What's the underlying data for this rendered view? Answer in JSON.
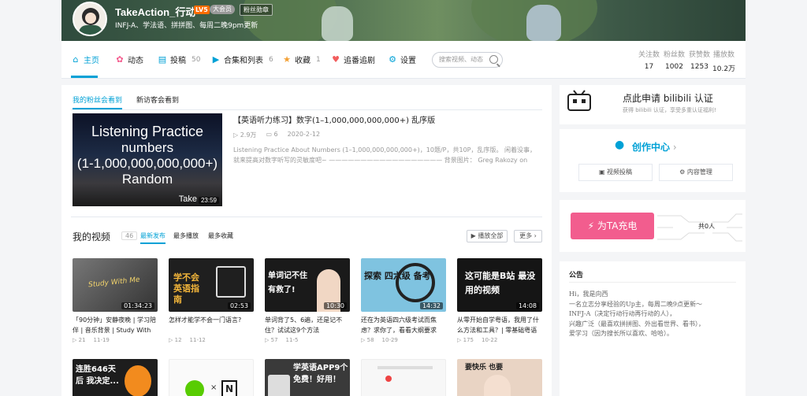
{
  "profile": {
    "username": "TakeAction_行动",
    "level": "LV5",
    "vip": "大会员",
    "fan_badge": "粉丝勋章",
    "sign": "INFJ-A、学法语、拼拼图、每周二晚9pm更新"
  },
  "nav": {
    "items": [
      {
        "label": "主页",
        "count": ""
      },
      {
        "label": "动态",
        "count": ""
      },
      {
        "label": "投稿",
        "count": "50"
      },
      {
        "label": "合集和列表",
        "count": "6"
      },
      {
        "label": "收藏",
        "count": "1"
      },
      {
        "label": "追番追剧",
        "count": ""
      },
      {
        "label": "设置",
        "count": ""
      }
    ],
    "search_placeholder": "搜索视频、动态",
    "stats": [
      {
        "label": "关注数",
        "value": "17"
      },
      {
        "label": "粉丝数",
        "value": "1002"
      },
      {
        "label": "获赞数",
        "value": "1253"
      },
      {
        "label": "播放数",
        "value": "10.2万"
      }
    ]
  },
  "featured": {
    "tabs": [
      "我的粉丝会看到",
      "新访客会看到"
    ],
    "thumb_lines": [
      "Listening Practice",
      "numbers",
      "(1-1,000,000,000,000+)",
      "Random"
    ],
    "thumb_corner": "Take",
    "duration": "23:59",
    "title": "【英语听力练习】数字(1–1,000,000,000,000+) 乱序版",
    "plays": "2.9万",
    "comments": "6",
    "date": "2020-2-12",
    "desc": "Listening Practice About Numbers (1–1,000,000,000,000+)，10题/P，共10P，乱序版。 闲着没事，就来提高对数字听写的灵敏度吧~ —————————————————— 背景图片： Greg Rakozy on"
  },
  "videos": {
    "header": "我的视频",
    "count": "46",
    "tabs": [
      "最新发布",
      "最多播放",
      "最多收藏"
    ],
    "play_all": "播放全部",
    "more": "更多",
    "items": [
      {
        "title": "「90分钟」安静夜晚 | 学习陪伴 | 音乐背景 | Study With",
        "thumb_text": "Study With Me",
        "duration": "01:34:23",
        "plays": "21",
        "date": "11-19"
      },
      {
        "title": "怎样才能学不会一门语言?",
        "thumb_text": "学不会英语指南",
        "duration": "02:53",
        "plays": "12",
        "date": "11-12"
      },
      {
        "title": "单词背了5、6遍，还是记不住？试试这9个方法",
        "thumb_text": "单词记不住 有救了!",
        "duration": "10:30",
        "plays": "57",
        "date": "11-5"
      },
      {
        "title": "还在为英语四六级考试而焦虑？求你了，看看大纲要求",
        "thumb_text": "探索 四六级 备考",
        "duration": "14:32",
        "plays": "58",
        "date": "10-29"
      },
      {
        "title": "从零开始自学粤语，我用了什么方法和工具？| 零基础粤语",
        "thumb_text": "这可能是B站 最没用的视频",
        "duration": "14:08",
        "plays": "175",
        "date": "10-22"
      }
    ],
    "row2": [
      {
        "thumb_text": "连胜646天后 我决定..."
      },
      {
        "thumb_text": "×"
      },
      {
        "thumb_text": "学英语APP9个 免费！好用！"
      },
      {
        "thumb_text": ""
      },
      {
        "thumb_text": "要快乐 也要"
      }
    ]
  },
  "side": {
    "apply_title": "点此申请 bilibili 认证",
    "apply_sub": "获得 bilibili 认证，享受多重认证福利!",
    "creator_title": "创作中心",
    "upload_btn": "视频投稿",
    "manage_btn": "内容管理",
    "charge_btn": "为TA充电",
    "charge_count": "共0人",
    "notice_title": "公告",
    "notice_body": "Hi，我是向西\n一名立志分享经验的Up主，每周二晚9点更新～\nINFJ-A（决定行动行动再行动的人），\n兴趣广泛（最喜欢拼拼图、外出看世界、看书），\n爱学习（因为搜长所以喜欢、哈哈）。"
  }
}
